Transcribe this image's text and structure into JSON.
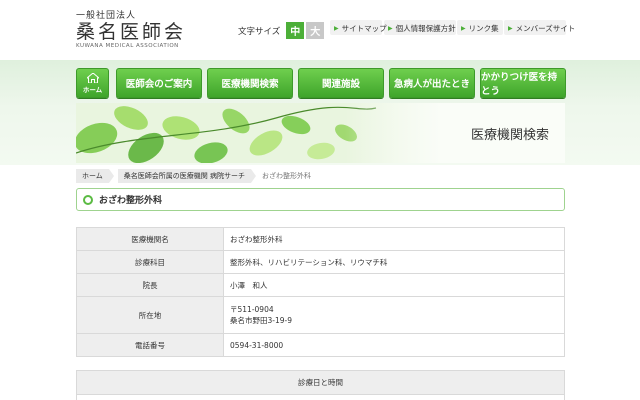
{
  "header": {
    "logo_sub": "一般社団法人",
    "logo_main": "桑名医師会",
    "logo_en": "KUWANA MEDICAL ASSOCIATION",
    "font_size_label": "文字サイズ",
    "font_size_medium": "中",
    "font_size_large": "大",
    "util_links": [
      "サイトマップ",
      "個人情報保護方針",
      "リンク集",
      "メンバーズサイト"
    ]
  },
  "nav": {
    "home_label": "ホーム",
    "items": [
      "医師会のご案内",
      "医療機関検索",
      "関連施設",
      "急病人が出たとき",
      "かかりつけ医を持とう"
    ]
  },
  "banner": {
    "title": "医療機関検索"
  },
  "breadcrumb": {
    "items": [
      "ホーム",
      "桑名医師会所属の医療機関 病院サーチ"
    ],
    "current": "おざわ整形外科"
  },
  "page_heading": "おざわ整形外科",
  "info_table": [
    {
      "label": "医療機関名",
      "value": "おざわ整形外科"
    },
    {
      "label": "診療科目",
      "value": "整形外科、リハビリテーション科、リウマチ科"
    },
    {
      "label": "院長",
      "value": "小澤　和人"
    },
    {
      "label": "所在地",
      "value_lines": [
        "〒511-0904",
        "桑名市野田3-19-9"
      ]
    },
    {
      "label": "電話番号",
      "value": "0594-31-8000"
    }
  ],
  "hours": {
    "heading": "診療日と時間"
  },
  "colors": {
    "accent": "#4caf38",
    "nav_top": "#6fcf4e",
    "nav_bottom": "#3fa52b",
    "table_header": "#eeeeee"
  }
}
